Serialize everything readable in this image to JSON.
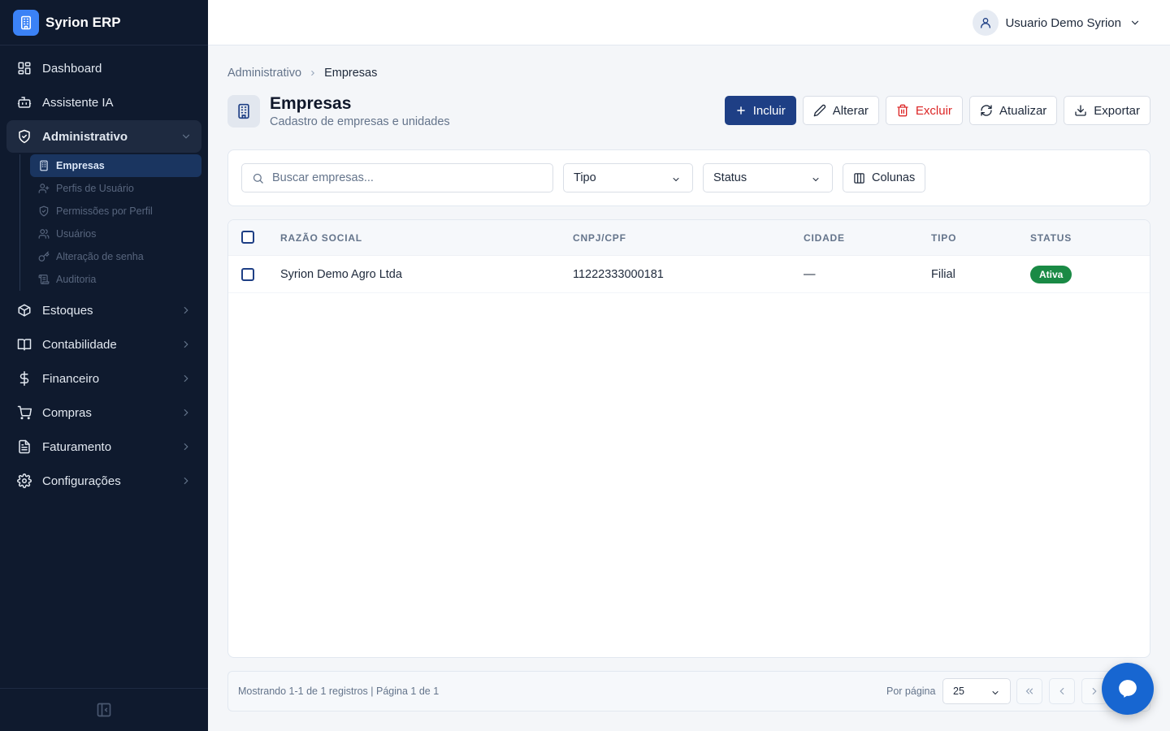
{
  "app": {
    "name": "Syrion ERP"
  },
  "sidebar": {
    "items": [
      {
        "label": "Dashboard",
        "icon": "dashboard-icon"
      },
      {
        "label": "Assistente IA",
        "icon": "bot-icon"
      },
      {
        "label": "Administrativo",
        "icon": "shield-icon",
        "expanded": true
      },
      {
        "label": "Estoques",
        "icon": "package-icon"
      },
      {
        "label": "Contabilidade",
        "icon": "book-icon"
      },
      {
        "label": "Financeiro",
        "icon": "dollar-icon"
      },
      {
        "label": "Compras",
        "icon": "cart-icon"
      },
      {
        "label": "Faturamento",
        "icon": "file-icon"
      },
      {
        "label": "Configurações",
        "icon": "gear-icon"
      }
    ],
    "sub_items": [
      {
        "label": "Empresas",
        "icon": "building-icon",
        "active": true
      },
      {
        "label": "Perfis de Usuário",
        "icon": "users-icon"
      },
      {
        "label": "Permissões por Perfil",
        "icon": "shield-check-icon"
      },
      {
        "label": "Usuários",
        "icon": "users-icon"
      },
      {
        "label": "Alteração de senha",
        "icon": "key-icon"
      },
      {
        "label": "Auditoria",
        "icon": "scroll-icon"
      }
    ]
  },
  "topbar": {
    "user_name": "Usuario Demo Syrion"
  },
  "breadcrumb": {
    "parent": "Administrativo",
    "current": "Empresas"
  },
  "page": {
    "title": "Empresas",
    "subtitle": "Cadastro de empresas e unidades"
  },
  "actions": {
    "include": "Incluir",
    "edit": "Alterar",
    "delete": "Excluir",
    "refresh": "Atualizar",
    "export": "Exportar"
  },
  "filters": {
    "search_placeholder": "Buscar empresas...",
    "type_label": "Tipo",
    "status_label": "Status",
    "columns_label": "Colunas"
  },
  "table": {
    "headers": [
      "RAZÃO SOCIAL",
      "CNPJ/CPF",
      "CIDADE",
      "TIPO",
      "STATUS"
    ],
    "rows": [
      {
        "razao_social": "Syrion Demo Agro Ltda",
        "cnpj_cpf": "11222333000181",
        "cidade": "—",
        "tipo": "Filial",
        "status": "Ativa"
      }
    ]
  },
  "footer": {
    "info": "Mostrando 1-1 de 1 registros | Página 1 de 1",
    "per_page_label": "Por página",
    "per_page_value": "25"
  },
  "colors": {
    "sidebar_bg": "#0f1a2e",
    "primary": "#1e3f85",
    "danger": "#dc2626",
    "success": "#1a8a45",
    "fab": "#1766d1"
  }
}
